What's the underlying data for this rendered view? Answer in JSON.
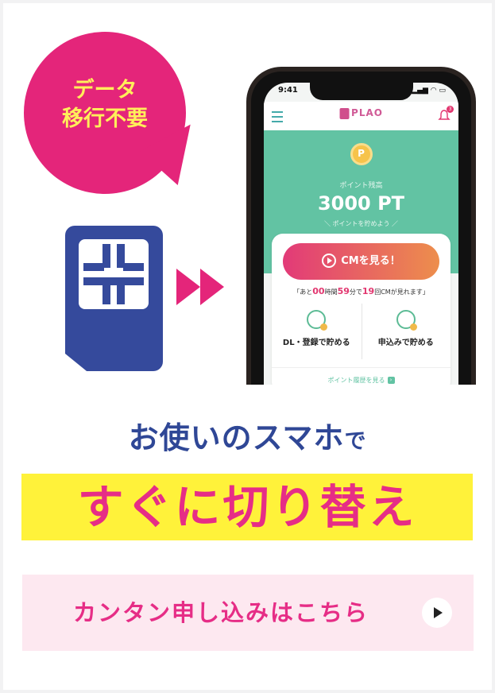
{
  "bubble": {
    "line1": "データ",
    "line2": "移行不要"
  },
  "phone": {
    "status_time": "9:41",
    "status_icons": "▂▄▆ ◠ ▭",
    "app_logo": "PLAO",
    "notification_count": "3",
    "points_label": "ポイント残高",
    "points_value": "3000 PT",
    "points_sub": "＼ ポイントを貯めよう ／",
    "cm_button": "CMを見る！",
    "remaining": {
      "prefix": "あと",
      "h": "00",
      "h_unit": "時間",
      "m": "59",
      "m_unit": "分で",
      "count": "19",
      "suffix": "回CMが見れます"
    },
    "action_left": "DL・登録で貯める",
    "action_right": "申込みで貯める",
    "history_link": "ポイント履歴を見る",
    "history_arrow": "›"
  },
  "headline1": {
    "main": "お使いのスマホ",
    "particle": "で"
  },
  "headline2": "すぐに切り替え",
  "cta": {
    "label": "カンタン申し込みはこちら"
  },
  "colors": {
    "magenta": "#e62d86",
    "navy": "#2f4796",
    "yellow": "#fff23a",
    "teal": "#62c3a3",
    "cta_bg": "#fde8f0"
  }
}
